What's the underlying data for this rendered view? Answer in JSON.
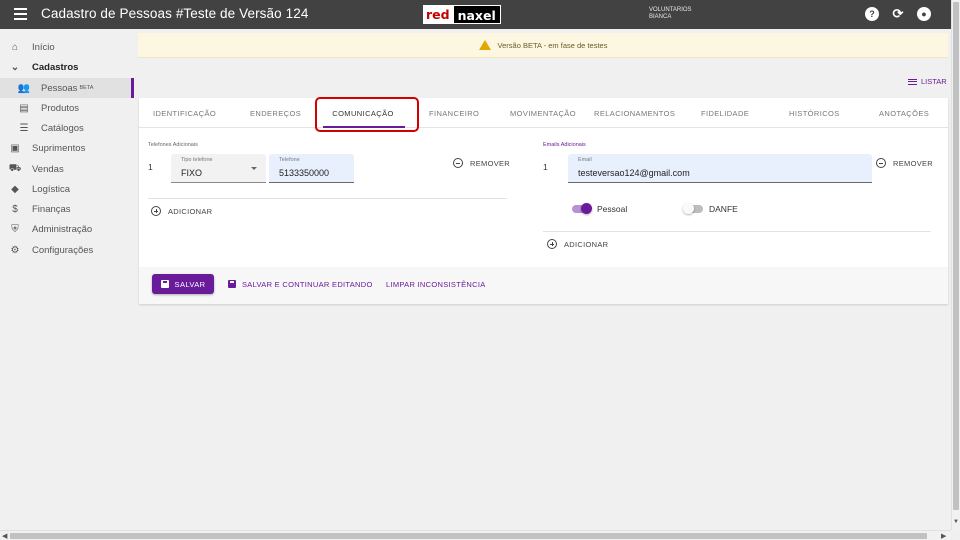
{
  "header": {
    "title": "Cadastro de Pessoas #Teste de Versão 124",
    "logo_red": "red",
    "logo_black": "naxel",
    "user_line1": "VOLUNTARIOS",
    "user_line2": "BIANCA",
    "icons": [
      "help-icon",
      "refresh-icon",
      "account-icon"
    ]
  },
  "sidebar": {
    "items": [
      {
        "label": "Início",
        "icon": "home-icon"
      },
      {
        "label": "Cadastros",
        "icon": "chevron-down-icon"
      },
      {
        "label": "Pessoas",
        "badge": "BETA",
        "icon": "people-icon"
      },
      {
        "label": "Produtos",
        "icon": "book-icon"
      },
      {
        "label": "Catálogos",
        "icon": "list-icon"
      },
      {
        "label": "Suprimentos",
        "icon": "briefcase-icon"
      },
      {
        "label": "Vendas",
        "icon": "cart-icon"
      },
      {
        "label": "Logística",
        "icon": "diamond-icon"
      },
      {
        "label": "Finanças",
        "icon": "dollar-icon"
      },
      {
        "label": "Administração",
        "icon": "shield-icon"
      },
      {
        "label": "Configurações",
        "icon": "gear-icon"
      }
    ]
  },
  "notice": {
    "text": "Versão BETA - em fase de testes"
  },
  "listar_label": "LISTAR",
  "tabs": [
    "IDENTIFICAÇÃO",
    "ENDEREÇOS",
    "COMUNICAÇÃO",
    "FINANCEIRO",
    "MOVIMENTAÇÃO",
    "RELACIONAMENTOS",
    "FIDELIDADE",
    "HISTÓRICOS",
    "ANOTAÇÕES"
  ],
  "active_tab": "COMUNICAÇÃO",
  "phones": {
    "section_label": "Telefones Adicionais",
    "row_number": "1",
    "type_label": "Tipo telefone",
    "type_value": "FIXO",
    "phone_label": "Telefone",
    "phone_value": "5133350000",
    "remove_label": "REMOVER",
    "add_label": "ADICIONAR"
  },
  "emails": {
    "section_label": "Emails Adicionais",
    "row_number": "1",
    "email_label": "Email",
    "email_value": "testeversao124@gmail.com",
    "remove_label": "REMOVER",
    "toggle_pessoal_label": "Pessoal",
    "toggle_pessoal_on": true,
    "toggle_danfe_label": "DANFE",
    "toggle_danfe_on": false,
    "add_label": "ADICIONAR"
  },
  "footer": {
    "save_label": "SALVAR",
    "save_continue_label": "SALVAR E CONTINUAR EDITANDO",
    "clear_label": "LIMPAR INCONSISTÊNCIA"
  },
  "colors": {
    "accent": "#6a1b9a",
    "topbar": "#424242",
    "highlight": "#d30000"
  }
}
